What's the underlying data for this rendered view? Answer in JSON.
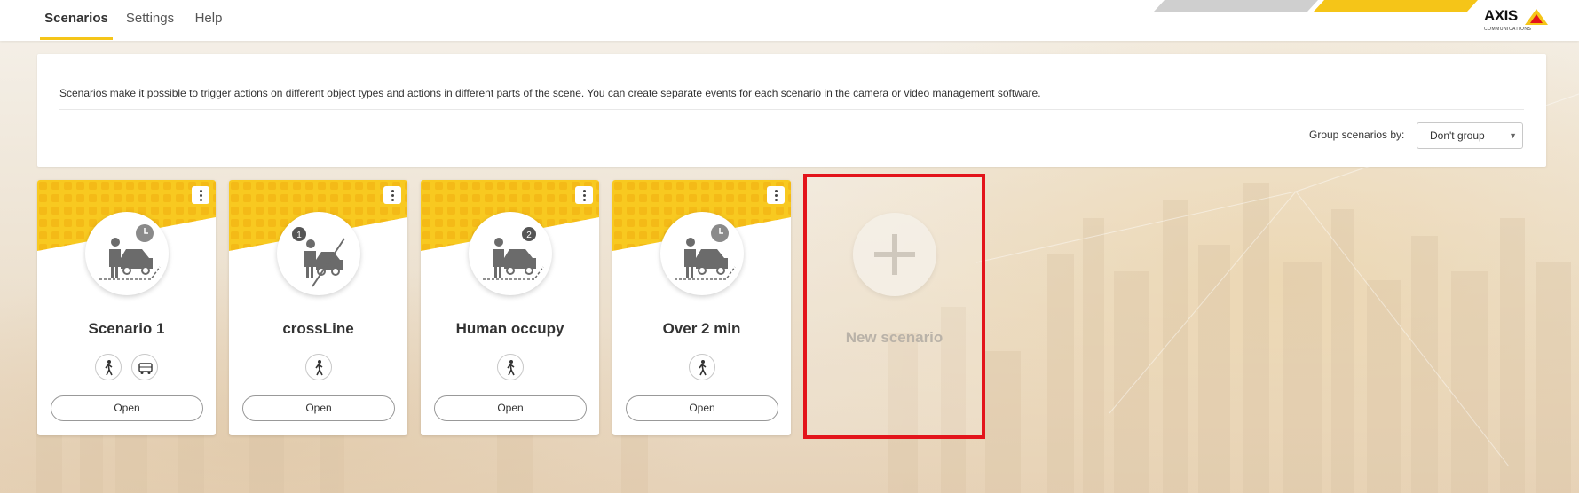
{
  "nav": {
    "tabs": [
      {
        "label": "Scenarios",
        "active": true
      },
      {
        "label": "Settings",
        "active": false
      },
      {
        "label": "Help",
        "active": false
      }
    ]
  },
  "brand": {
    "logo_text": "AXIS",
    "logo_subtext": "COMMUNICATIONS",
    "accent_color": "#f5c518",
    "highlight_color": "#e3141b"
  },
  "info": {
    "description": "Scenarios make it possible to trigger actions on different object types and actions in different parts of the scene. You can create separate events for each scenario in the camera or video management software.",
    "group_label": "Group scenarios by:",
    "group_value": "Don't group"
  },
  "scenarios": [
    {
      "title": "Scenario 1",
      "icon": "occupancy-timer-icon",
      "objects": [
        "human-icon",
        "vehicle-icon"
      ],
      "open_label": "Open"
    },
    {
      "title": "crossLine",
      "icon": "line-crossing-icon",
      "objects": [
        "human-icon"
      ],
      "open_label": "Open"
    },
    {
      "title": "Human occupy",
      "icon": "occupancy-count-icon",
      "objects": [
        "human-icon"
      ],
      "open_label": "Open"
    },
    {
      "title": "Over 2 min",
      "icon": "occupancy-timer-icon",
      "objects": [
        "human-icon"
      ],
      "open_label": "Open"
    }
  ],
  "new_scenario": {
    "label": "New scenario",
    "icon": "plus-icon"
  }
}
